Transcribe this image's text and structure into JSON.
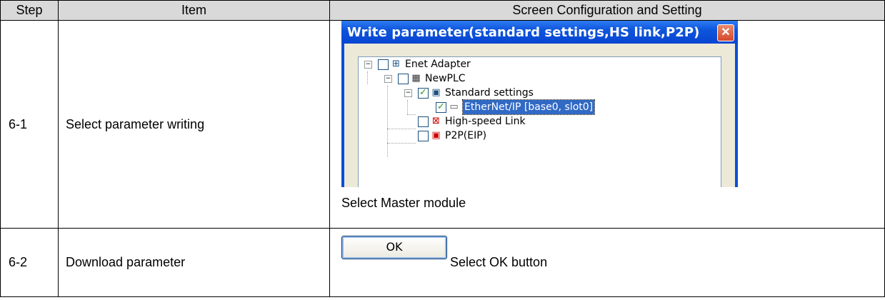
{
  "headers": {
    "step": "Step",
    "item": "Item",
    "config": "Screen Configuration and Setting"
  },
  "rows": [
    {
      "step": "6-1",
      "item": "Select parameter writing",
      "caption": "Select Master module"
    },
    {
      "step": "6-2",
      "item": "Download parameter",
      "caption": "Select OK button"
    }
  ],
  "dialog": {
    "title": "Write parameter(standard settings,HS link,P2P)",
    "close": "✕",
    "tree": [
      {
        "label": "Enet Adapter",
        "icon": "network-adapter-icon",
        "checked": false
      },
      {
        "label": "NewPLC",
        "icon": "plc-icon",
        "checked": false
      },
      {
        "label": "Standard settings",
        "icon": "settings-icon",
        "checked": true
      },
      {
        "label": "EtherNet/IP [base0, slot0]",
        "icon": "ethernet-module-icon",
        "checked": true,
        "selected": true
      },
      {
        "label": "High-speed Link",
        "icon": "hs-link-icon",
        "checked": false
      },
      {
        "label": "P2P(EIP)",
        "icon": "p2p-icon",
        "checked": false
      }
    ]
  },
  "ok_button": {
    "label": "OK"
  },
  "colors": {
    "header_bg": "#d9d9d9",
    "titlebar": "#0a4fd8",
    "selection": "#316ac5"
  }
}
